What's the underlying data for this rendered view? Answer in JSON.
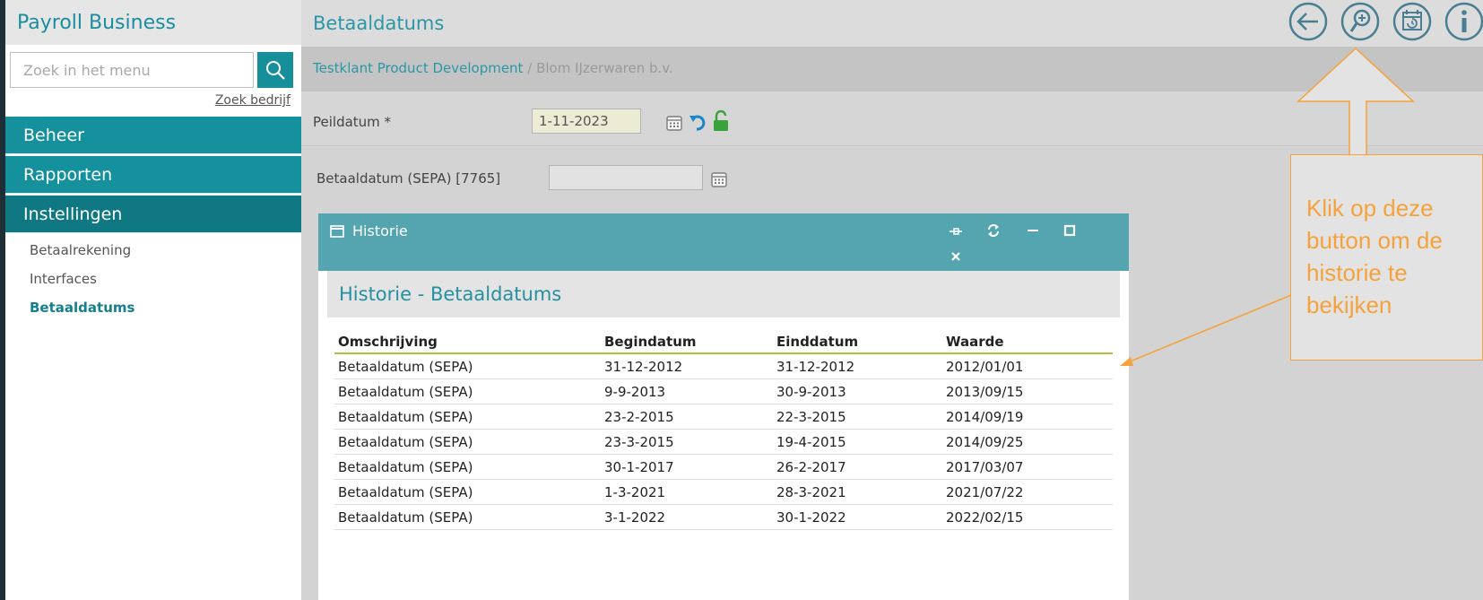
{
  "app": {
    "brand": "Payroll Business"
  },
  "search": {
    "placeholder": "Zoek in het menu",
    "company_link": "Zoek bedrijf"
  },
  "nav": {
    "sections": [
      {
        "label": "Beheer"
      },
      {
        "label": "Rapporten"
      },
      {
        "label": "Instellingen"
      }
    ],
    "sub_items": [
      {
        "label": "Betaalrekening"
      },
      {
        "label": "Interfaces"
      },
      {
        "label": "Betaaldatums"
      }
    ]
  },
  "header": {
    "title": "Betaaldatums",
    "icons": [
      "back-arrow-icon",
      "search-zoom-icon",
      "history-calendar-icon",
      "info-icon"
    ]
  },
  "breadcrumb": {
    "client": "Testklant Product Development",
    "separator": "/",
    "company": "Blom IJzerwaren b.v."
  },
  "form": {
    "peildatum_label": "Peildatum *",
    "peildatum_value": "1-11-2023",
    "sepa_label": "Betaaldatum (SEPA) [7765]",
    "sepa_value": ""
  },
  "dialog": {
    "title": "Historie",
    "heading": "Historie - Betaaldatums",
    "columns": [
      "Omschrijving",
      "Begindatum",
      "Einddatum",
      "Waarde"
    ],
    "rows": [
      [
        "Betaaldatum (SEPA)",
        "31-12-2012",
        "31-12-2012",
        "2012/01/01"
      ],
      [
        "Betaaldatum (SEPA)",
        "9-9-2013",
        "30-9-2013",
        "2013/09/15"
      ],
      [
        "Betaaldatum (SEPA)",
        "23-2-2015",
        "22-3-2015",
        "2014/09/19"
      ],
      [
        "Betaaldatum (SEPA)",
        "23-3-2015",
        "19-4-2015",
        "2014/09/25"
      ],
      [
        "Betaaldatum (SEPA)",
        "30-1-2017",
        "26-2-2017",
        "2017/03/07"
      ],
      [
        "Betaaldatum (SEPA)",
        "1-3-2021",
        "28-3-2021",
        "2021/07/22"
      ],
      [
        "Betaaldatum (SEPA)",
        "3-1-2022",
        "30-1-2022",
        "2022/02/15"
      ]
    ]
  },
  "callout": {
    "text": "Klik op deze button om de historie te bekijken"
  },
  "colors": {
    "teal": "#15909d",
    "teal_dark": "#0f7883",
    "accent_orange": "#f6a23c",
    "lime_rule": "#a8c63a"
  }
}
